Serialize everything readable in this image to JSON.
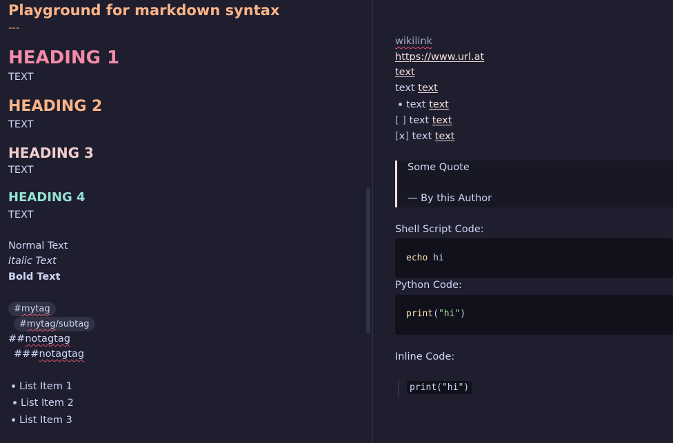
{
  "left": {
    "title": "Playground for markdown syntax",
    "dashes": "---",
    "heading1": "HEADING 1",
    "heading2": "HEADING 2",
    "heading3": "HEADING 3",
    "heading4": "HEADING 4",
    "text_label": "TEXT",
    "normal": "Normal Text",
    "italic": "Italic Text",
    "bold": "Bold Text",
    "tag1_hash": "#",
    "tag1_word": "mytag",
    "tag2_hash": "#",
    "tag2_word": "mytag",
    "tag2_rest": "/subtag",
    "notag1_hash": "##",
    "notag1_word": "notagtag",
    "notag2_hash": "###",
    "notag2_word": "notagtag",
    "list": [
      "List Item 1",
      "List Item 2",
      "List Item 3"
    ]
  },
  "right": {
    "wikilink": "wikilink",
    "url": "https://www.url.at",
    "link_text": "text",
    "plain_text": "text",
    "checkbox_empty": "[ ]",
    "checkbox_checked_open": "[",
    "checkbox_checked_x": "x",
    "checkbox_checked_close": "]",
    "quote_text": "Some Quote",
    "quote_author": "— By this Author",
    "shell_label": "Shell Script Code:",
    "shell_cmd": "echo",
    "shell_arg": "hi",
    "python_label": "Python Code:",
    "python_fn": "print",
    "python_open": "(",
    "python_str": "\"hi\"",
    "python_close": ")",
    "inline_label": "Inline Code:",
    "inline_code": "print(\"hi\")"
  },
  "colors": {
    "background": "#1e1e2e",
    "title": "#fab387",
    "heading1": "#f38ba8",
    "heading2": "#fab387",
    "heading3": "#f2cdcd",
    "heading4": "#94e2d5",
    "code_keyword": "#f9e2af",
    "code_string": "#a6e3a1",
    "quote_border": "#f5e0dc"
  }
}
